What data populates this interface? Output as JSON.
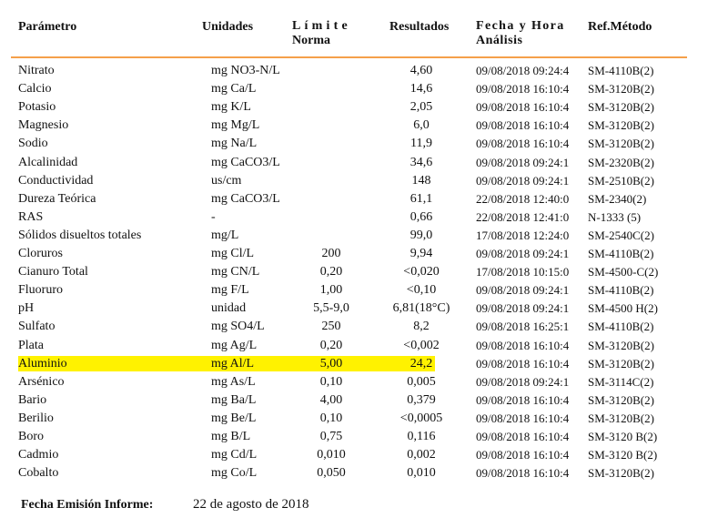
{
  "header": {
    "parametro": "Parámetro",
    "unidades": "Unidades",
    "limite_line1": "Límite",
    "limite_line2": "Norma",
    "resultados": "Resultados",
    "fecha_line1": "Fecha y Hora",
    "fecha_line2": "Análisis",
    "ref_metodo": "Ref.Método"
  },
  "colors": {
    "header_rule": "#f5a04a",
    "highlight": "#fff200"
  },
  "rows": [
    {
      "parametro": "Nitrato",
      "unidades": "mg NO3-N/L",
      "limite": "",
      "resultado": "4,60",
      "fecha": "09/08/2018 09:24:4",
      "ref": "SM-4110B(2)",
      "highlighted": false
    },
    {
      "parametro": "Calcio",
      "unidades": "mg Ca/L",
      "limite": "",
      "resultado": "14,6",
      "fecha": "09/08/2018 16:10:4",
      "ref": "SM-3120B(2)",
      "highlighted": false
    },
    {
      "parametro": "Potasio",
      "unidades": "mg K/L",
      "limite": "",
      "resultado": "2,05",
      "fecha": "09/08/2018 16:10:4",
      "ref": "SM-3120B(2)",
      "highlighted": false
    },
    {
      "parametro": "Magnesio",
      "unidades": "mg Mg/L",
      "limite": "",
      "resultado": "6,0",
      "fecha": "09/08/2018 16:10:4",
      "ref": "SM-3120B(2)",
      "highlighted": false
    },
    {
      "parametro": "Sodio",
      "unidades": "mg Na/L",
      "limite": "",
      "resultado": "11,9",
      "fecha": "09/08/2018 16:10:4",
      "ref": "SM-3120B(2)",
      "highlighted": false
    },
    {
      "parametro": "Alcalinidad",
      "unidades": "mg CaCO3/L",
      "limite": "",
      "resultado": "34,6",
      "fecha": "09/08/2018 09:24:1",
      "ref": "SM-2320B(2)",
      "highlighted": false
    },
    {
      "parametro": "Conductividad",
      "unidades": "us/cm",
      "limite": "",
      "resultado": "148",
      "fecha": "09/08/2018 09:24:1",
      "ref": "SM-2510B(2)",
      "highlighted": false
    },
    {
      "parametro": "Dureza Teórica",
      "unidades": "mg CaCO3/L",
      "limite": "",
      "resultado": "61,1",
      "fecha": "22/08/2018 12:40:0",
      "ref": "SM-2340(2)",
      "highlighted": false
    },
    {
      "parametro": "RAS",
      "unidades": "-",
      "limite": "",
      "resultado": "0,66",
      "fecha": "22/08/2018 12:41:0",
      "ref": "N-1333 (5)",
      "highlighted": false
    },
    {
      "parametro": "Sólidos disueltos totales",
      "unidades": "mg/L",
      "limite": "",
      "resultado": "99,0",
      "fecha": "17/08/2018 12:24:0",
      "ref": "SM-2540C(2)",
      "highlighted": false
    },
    {
      "parametro": "Cloruros",
      "unidades": "mg Cl/L",
      "limite": "200",
      "resultado": "9,94",
      "fecha": "09/08/2018 09:24:1",
      "ref": "SM-4110B(2)",
      "highlighted": false
    },
    {
      "parametro": "Cianuro Total",
      "unidades": "mg CN/L",
      "limite": "0,20",
      "resultado": "<0,020",
      "fecha": "17/08/2018 10:15:0",
      "ref": "SM-4500-C(2)",
      "highlighted": false
    },
    {
      "parametro": "Fluoruro",
      "unidades": "mg F/L",
      "limite": "1,00",
      "resultado": "<0,10",
      "fecha": "09/08/2018 09:24:1",
      "ref": "SM-4110B(2)",
      "highlighted": false
    },
    {
      "parametro": "pH",
      "unidades": "unidad",
      "limite": "5,5-9,0",
      "resultado": "6,81(18°C)",
      "fecha": "09/08/2018 09:24:1",
      "ref": "SM-4500 H(2)",
      "highlighted": false
    },
    {
      "parametro": "Sulfato",
      "unidades": "mg SO4/L",
      "limite": "250",
      "resultado": "8,2",
      "fecha": "09/08/2018 16:25:1",
      "ref": "SM-4110B(2)",
      "highlighted": false
    },
    {
      "parametro": "Plata",
      "unidades": "mg Ag/L",
      "limite": "0,20",
      "resultado": "<0,002",
      "fecha": "09/08/2018 16:10:4",
      "ref": "SM-3120B(2)",
      "highlighted": false
    },
    {
      "parametro": "Aluminio",
      "unidades": "mg Al/L",
      "limite": "5,00",
      "resultado": "24,2",
      "fecha": "09/08/2018 16:10:4",
      "ref": "SM-3120B(2)",
      "highlighted": true
    },
    {
      "parametro": "Arsénico",
      "unidades": "mg As/L",
      "limite": "0,10",
      "resultado": "0,005",
      "fecha": "09/08/2018 09:24:1",
      "ref": "SM-3114C(2)",
      "highlighted": false
    },
    {
      "parametro": "Bario",
      "unidades": "mg Ba/L",
      "limite": "4,00",
      "resultado": "0,379",
      "fecha": "09/08/2018 16:10:4",
      "ref": "SM-3120B(2)",
      "highlighted": false
    },
    {
      "parametro": "Berilio",
      "unidades": "mg Be/L",
      "limite": "0,10",
      "resultado": "<0,0005",
      "fecha": "09/08/2018 16:10:4",
      "ref": "SM-3120B(2)",
      "highlighted": false
    },
    {
      "parametro": "Boro",
      "unidades": "mg B/L",
      "limite": "0,75",
      "resultado": "0,116",
      "fecha": "09/08/2018 16:10:4",
      "ref": "SM-3120 B(2)",
      "highlighted": false
    },
    {
      "parametro": "Cadmio",
      "unidades": "mg Cd/L",
      "limite": "0,010",
      "resultado": "0,002",
      "fecha": "09/08/2018 16:10:4",
      "ref": "SM-3120 B(2)",
      "highlighted": false
    },
    {
      "parametro": "Cobalto",
      "unidades": "mg Co/L",
      "limite": "0,050",
      "resultado": "0,010",
      "fecha": "09/08/2018 16:10:4",
      "ref": "SM-3120B(2)",
      "highlighted": false
    }
  ],
  "footer": {
    "label": "Fecha Emisión Informe:",
    "value": "22 de agosto de 2018"
  }
}
